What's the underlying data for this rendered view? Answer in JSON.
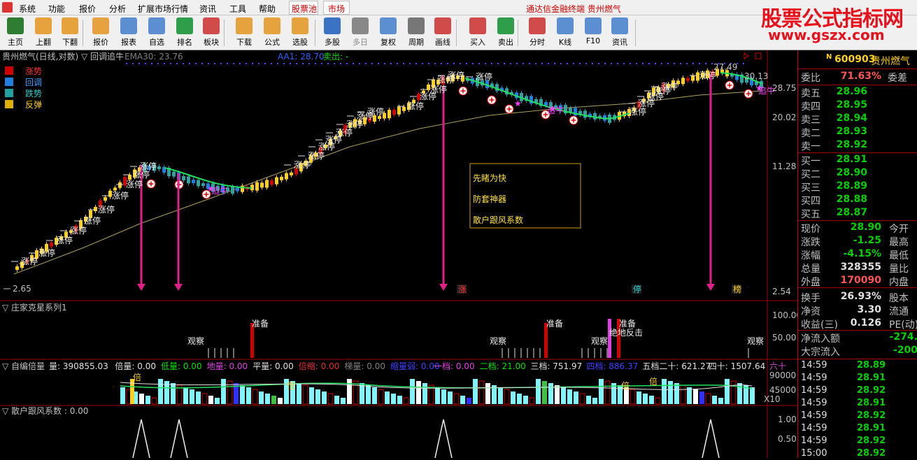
{
  "menu": {
    "items": [
      "系统",
      "功能",
      "报价",
      "分析",
      "扩展市场行情",
      "资讯",
      "工具",
      "帮助"
    ],
    "tabs": [
      "股票池",
      "市场"
    ],
    "center_title": "通达信金融终端  贵州燃气"
  },
  "toolbar": {
    "buttons": [
      {
        "label": "主页",
        "icon": "home-icon",
        "color": "#2e7d32"
      },
      {
        "label": "上翻",
        "icon": "arrow-up-icon",
        "color": "#e6a23c"
      },
      {
        "label": "下翻",
        "icon": "arrow-down-icon",
        "color": "#e6a23c"
      },
      {
        "label": "报价",
        "icon": "quote-icon",
        "color": "#e6a23c"
      },
      {
        "label": "报表",
        "icon": "report-icon",
        "color": "#5b8fd1"
      },
      {
        "label": "自选",
        "icon": "favorites-icon",
        "color": "#5b8fd1"
      },
      {
        "label": "排名",
        "icon": "ranking-icon",
        "color": "#2e9e4a"
      },
      {
        "label": "板块",
        "icon": "sector-icon",
        "color": "#d14b4b"
      },
      {
        "label": "下载",
        "icon": "download-icon",
        "color": "#e6a23c"
      },
      {
        "label": "公式",
        "icon": "formula-icon",
        "color": "#e6a23c"
      },
      {
        "label": "选股",
        "icon": "stock-picker-icon",
        "color": "#e6a23c"
      },
      {
        "label": "多股",
        "icon": "multi-stock-icon",
        "color": "#3b73c4"
      },
      {
        "label": "多日",
        "icon": "multi-day-icon",
        "color": "#888888"
      },
      {
        "label": "复权",
        "icon": "adjust-icon",
        "color": "#5b8fd1"
      },
      {
        "label": "周期",
        "icon": "period-icon",
        "color": "#777777"
      },
      {
        "label": "画线",
        "icon": "draw-line-icon",
        "color": "#d14b4b"
      },
      {
        "label": "买入",
        "icon": "buy-icon",
        "color": "#d14b4b"
      },
      {
        "label": "卖出",
        "icon": "sell-icon",
        "color": "#2e9e4a"
      },
      {
        "label": "分时",
        "icon": "timeshare-icon",
        "color": "#d14b4b"
      },
      {
        "label": "K线",
        "icon": "kline-icon",
        "color": "#5b8fd1"
      },
      {
        "label": "F10",
        "icon": "f10-icon",
        "color": "#5b8fd1"
      },
      {
        "label": "资讯",
        "icon": "news-icon",
        "color": "#5b8fd1"
      }
    ]
  },
  "watermark": {
    "title": "股票公式指标网",
    "url": "www.gszx.com"
  },
  "main_chart": {
    "title": "贵州燃气(日线,对数) ▽ 回调追牛",
    "ema_label": "EMA30: 23.76",
    "aa_label": "AA1: 28.70",
    "sell_label": "卖出: -",
    "legend": [
      {
        "label": "涨势",
        "color": "#d00000"
      },
      {
        "label": "回调",
        "color": "#2080e0"
      },
      {
        "label": "跌势",
        "color": "#20a0a0"
      },
      {
        "label": "反弹",
        "color": "#e0b000"
      }
    ],
    "y_ticks": [
      "28.75",
      "20.02",
      "11.28",
      "2.54"
    ],
    "low_label": "2.65",
    "high_label": "27.49",
    "right_price": "30.13",
    "ad_lines": [
      "先睹为快",
      "防套神器",
      "散户跟风系数"
    ],
    "marks": {
      "limit_up": "涨停",
      "chase": "追牛",
      "buy": "买进"
    },
    "bottom_tags": [
      "涨",
      "停",
      "榜"
    ]
  },
  "panel2": {
    "title": "▽ 庄家克星系列1",
    "y_ticks": [
      "100.00",
      "50.00"
    ],
    "labels": [
      "观察",
      "准备",
      "观察",
      "准备",
      "观察",
      "准备",
      "绝地反击",
      "观察"
    ]
  },
  "panel3": {
    "title": "▽ 自编倍量",
    "items": [
      {
        "text": "量: 390855.03",
        "color": "#e0e0e0"
      },
      {
        "text": "倍量: 0.00",
        "color": "#e0e0e0"
      },
      {
        "text": "低量: 0.00",
        "color": "#00e000"
      },
      {
        "text": "地量: 0.00",
        "color": "#e040e0"
      },
      {
        "text": "平量: 0.00",
        "color": "#e0e0e0"
      },
      {
        "text": "倍缩: 0.00",
        "color": "#e03030"
      },
      {
        "text": "梯量: 0.00",
        "color": "#808080"
      },
      {
        "text": "缩量弱: 0.00",
        "color": "#4040ff"
      },
      {
        "text": "一档: 0.00",
        "color": "#e040e0"
      },
      {
        "text": "二档: 21.00",
        "color": "#00e000"
      },
      {
        "text": "三档: 751.97",
        "color": "#e0e0e0"
      },
      {
        "text": "四档: 886.37",
        "color": "#4040ff"
      },
      {
        "text": "五档二十: 621.27",
        "color": "#e0e0e0"
      },
      {
        "text": "四十: 1507.64",
        "color": "#e0e0e0"
      },
      {
        "text": "六十",
        "color": "#e040e0"
      }
    ],
    "y_ticks": [
      "90000",
      "45000"
    ],
    "scale": "X10",
    "mark": "倍"
  },
  "panel4": {
    "title": "▽ 散户跟风系数 : 0.00",
    "y_ticks": [
      "1.00",
      "0.50"
    ]
  },
  "quote": {
    "code_flag": "N",
    "code": "600903",
    "name": "贵州燃气",
    "weibi": {
      "label": "委比",
      "value": "71.63%",
      "right": "委差"
    },
    "asks": [
      {
        "label": "卖五",
        "price": "28.96"
      },
      {
        "label": "卖四",
        "price": "28.95"
      },
      {
        "label": "卖三",
        "price": "28.94"
      },
      {
        "label": "卖二",
        "price": "28.93"
      },
      {
        "label": "卖一",
        "price": "28.92"
      }
    ],
    "bids": [
      {
        "label": "买一",
        "price": "28.91"
      },
      {
        "label": "买二",
        "price": "28.90"
      },
      {
        "label": "买三",
        "price": "28.89"
      },
      {
        "label": "买四",
        "price": "28.88"
      },
      {
        "label": "买五",
        "price": "28.87"
      }
    ],
    "stats": [
      {
        "label": "现价",
        "value": "28.90",
        "right": "今开",
        "color": "g"
      },
      {
        "label": "涨跌",
        "value": "-1.25",
        "right": "最高",
        "color": "g"
      },
      {
        "label": "涨幅",
        "value": "-4.15%",
        "right": "最低",
        "color": "g"
      },
      {
        "label": "总量",
        "value": "328355",
        "right": "量比",
        "color": "w"
      },
      {
        "label": "外盘",
        "value": "170090",
        "right": "内盘",
        "color": "r"
      },
      {
        "label": "换手",
        "value": "26.93%",
        "right": "股本",
        "color": "w"
      },
      {
        "label": "净资",
        "value": "3.30",
        "right": "流通",
        "color": "w"
      },
      {
        "label": "收益(三)",
        "value": "0.126",
        "right": "PE(动)",
        "color": "w"
      },
      {
        "label": "净流入额",
        "value": "-274.",
        "right": "",
        "color": "g"
      },
      {
        "label": "大宗流入",
        "value": "-200",
        "right": "",
        "color": "g"
      }
    ],
    "ticks": [
      {
        "time": "14:59",
        "price": "28.89"
      },
      {
        "time": "14:59",
        "price": "28.91"
      },
      {
        "time": "14:59",
        "price": "28.92"
      },
      {
        "time": "14:59",
        "price": "28.91"
      },
      {
        "time": "14:59",
        "price": "28.92"
      },
      {
        "time": "14:59",
        "price": "28.91"
      },
      {
        "time": "14:59",
        "price": "28.92"
      },
      {
        "time": "15:00",
        "price": "28.92"
      }
    ]
  }
}
